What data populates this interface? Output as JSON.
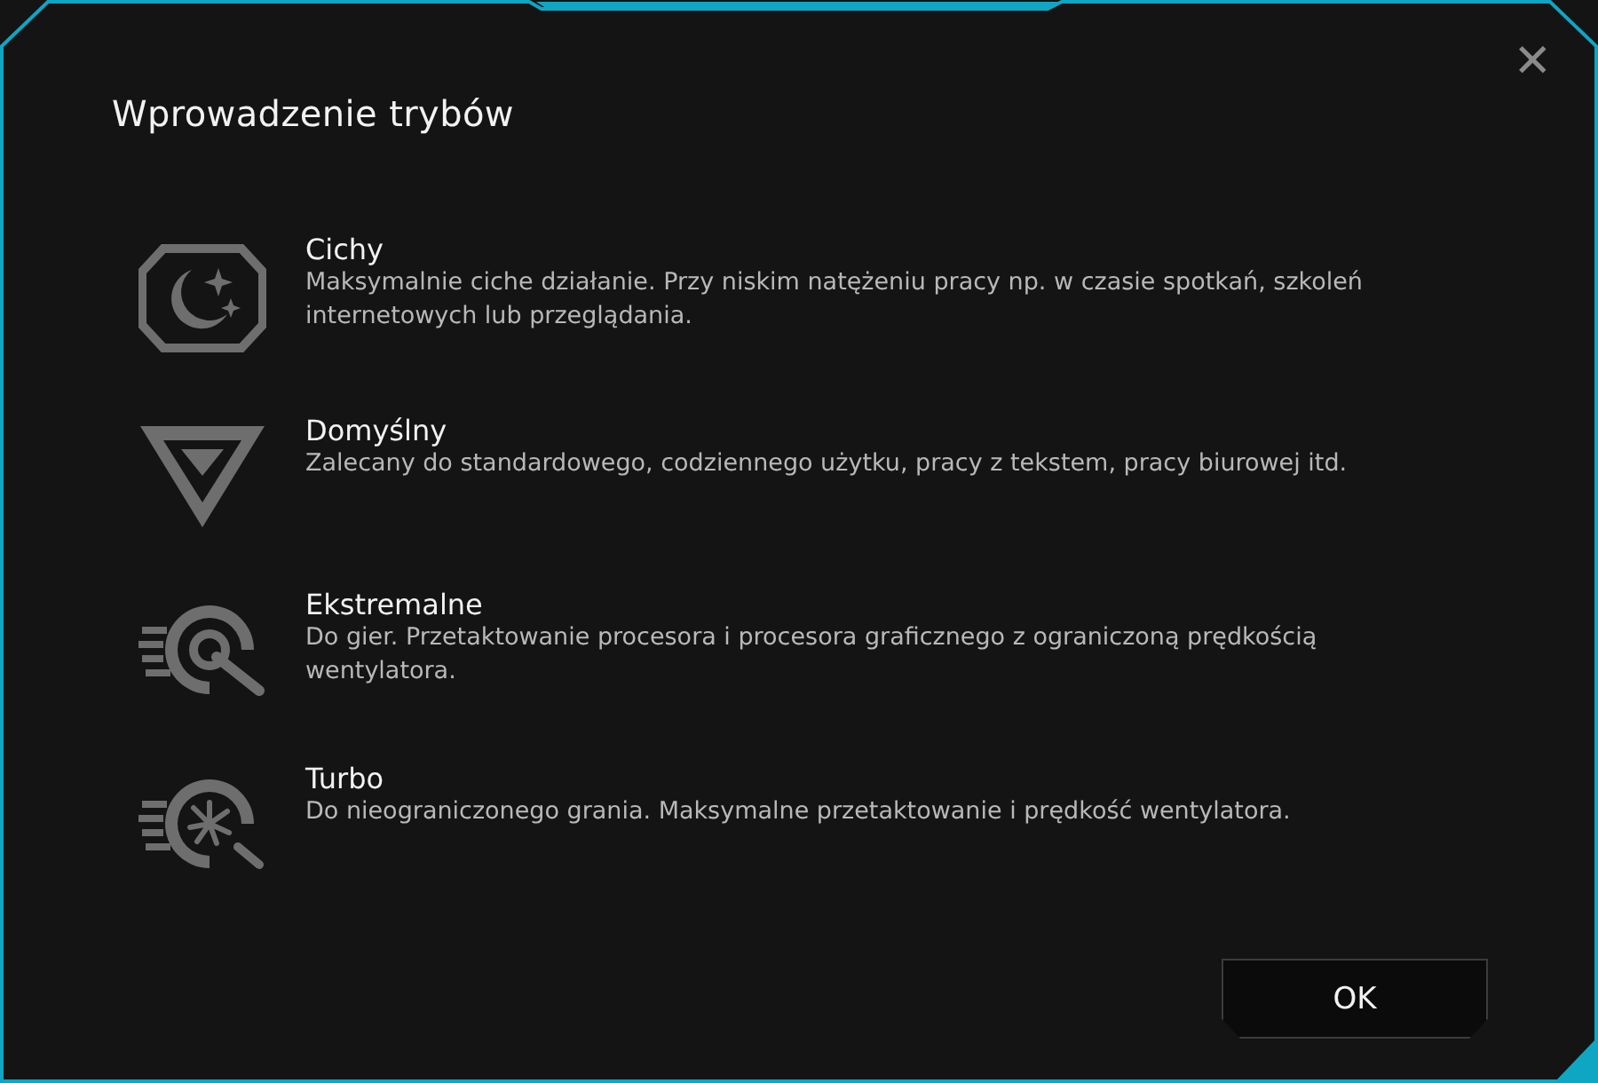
{
  "dialog": {
    "title": "Wprowadzenie trybów",
    "close": "✕"
  },
  "modes": [
    {
      "kind": "quiet",
      "name": "Cichy",
      "description": "Maksymalnie ciche działanie. Przy niskim natężeniu pracy np. w czasie spotkań, szkoleń internetowych lub przeglądania."
    },
    {
      "kind": "default",
      "name": "Domyślny",
      "description": "Zalecany do standardowego, codziennego użytku, pracy z tekstem, pracy biurowej itd."
    },
    {
      "kind": "extreme",
      "name": "Ekstremalne",
      "description": "Do gier. Przetaktowanie procesora i procesora graficznego z ograniczoną prędkością wentylatora."
    },
    {
      "kind": "turbo",
      "name": "Turbo",
      "description": "Do nieograniczonego grania. Maksymalne przetaktowanie i prędkość wentylatora."
    }
  ],
  "buttons": [
    "OK"
  ]
}
